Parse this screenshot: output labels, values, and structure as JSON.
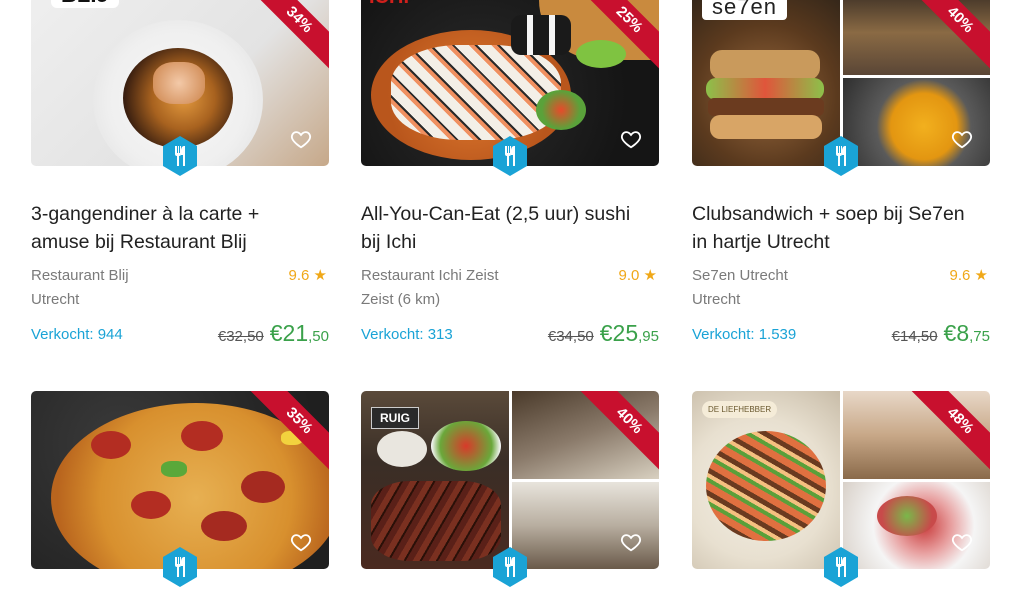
{
  "deals": [
    {
      "discount": "34%",
      "title_line1": "3-gangendiner à la carte +",
      "title_line2": "amuse bij Restaurant Blij",
      "restaurant": "Restaurant Blij",
      "location": "Utrecht",
      "rating": "9.6 ★",
      "sold": "Verkocht: 944",
      "old_price": "€32,50",
      "price_main": "€21",
      "price_cents": ",50",
      "logo": "BLIJ",
      "category_icon": "fork-knife-icon"
    },
    {
      "discount": "25%",
      "title_line1": "All-You-Can-Eat (2,5 uur) sushi",
      "title_line2": "bij Ichi",
      "restaurant": "Restaurant Ichi Zeist",
      "location": "Zeist (6 km)",
      "rating": "9.0 ★",
      "sold": "Verkocht: 313",
      "old_price": "€34,50",
      "price_main": "€25",
      "price_cents": ",95",
      "logo": "ICHI",
      "category_icon": "fork-knife-icon"
    },
    {
      "discount": "40%",
      "title_line1": "Clubsandwich + soep bij Se7en",
      "title_line2": "in hartje Utrecht",
      "restaurant": "Se7en Utrecht",
      "location": "Utrecht",
      "rating": "9.6 ★",
      "sold": "Verkocht: 1.539",
      "old_price": "€14,50",
      "price_main": "€8",
      "price_cents": ",75",
      "logo": "se7en",
      "category_icon": "fork-knife-icon"
    },
    {
      "discount": "35%",
      "category_icon": "fork-knife-icon"
    },
    {
      "discount": "40%",
      "logo": "RUIG",
      "category_icon": "fork-knife-icon"
    },
    {
      "discount": "48%",
      "logo": "DE LIEFHEBBER",
      "category_icon": "fork-knife-icon"
    }
  ],
  "colors": {
    "ribbon": "#c8102e",
    "badge": "#1aa3d6",
    "price": "#3aa14a",
    "rating": "#f0a818",
    "sold": "#1aa3d6"
  }
}
